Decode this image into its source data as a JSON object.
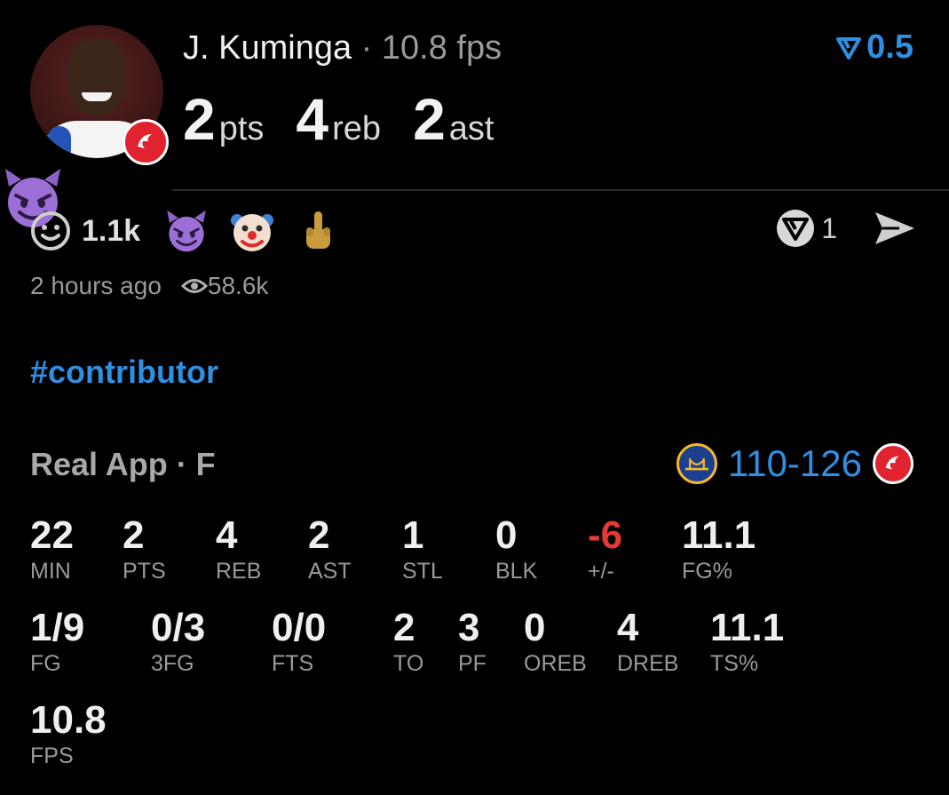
{
  "header": {
    "player_name": "J. Kuminga",
    "separator": "·",
    "player_fps": "10.8 fps",
    "rating": "0.5",
    "statline": [
      {
        "num": "2",
        "unit": "pts"
      },
      {
        "num": "4",
        "unit": "reb"
      },
      {
        "num": "2",
        "unit": "ast"
      }
    ]
  },
  "reactions": {
    "count": "1.1k",
    "emojis": [
      "smiling-devil",
      "clown",
      "middle-finger"
    ],
    "share_count": "1"
  },
  "meta": {
    "time_ago": "2 hours ago",
    "views": "58.6k"
  },
  "hashtag": "#contributor",
  "game": {
    "source": "Real App · F",
    "score": "110-126"
  },
  "stats_row1": [
    {
      "value": "22",
      "label": "MIN"
    },
    {
      "value": "2",
      "label": "PTS"
    },
    {
      "value": "4",
      "label": "REB"
    },
    {
      "value": "2",
      "label": "AST"
    },
    {
      "value": "1",
      "label": "STL"
    },
    {
      "value": "0",
      "label": "BLK"
    },
    {
      "value": "-6",
      "label": "+/-"
    },
    {
      "value": "11.1",
      "label": "FG%"
    }
  ],
  "stats_row2": [
    {
      "value": "1/9",
      "label": "FG"
    },
    {
      "value": "0/3",
      "label": "3FG"
    },
    {
      "value": "0/0",
      "label": "FTS"
    },
    {
      "value": "2",
      "label": "TO"
    },
    {
      "value": "3",
      "label": "PF"
    },
    {
      "value": "0",
      "label": "OREB"
    },
    {
      "value": "4",
      "label": "DREB"
    },
    {
      "value": "11.1",
      "label": "TS%"
    }
  ],
  "stats_row3": [
    {
      "value": "10.8",
      "label": "FPS"
    }
  ],
  "colors": {
    "accent": "#2f8fe0",
    "negative": "#e53935",
    "hawks_red": "#e0232f"
  }
}
